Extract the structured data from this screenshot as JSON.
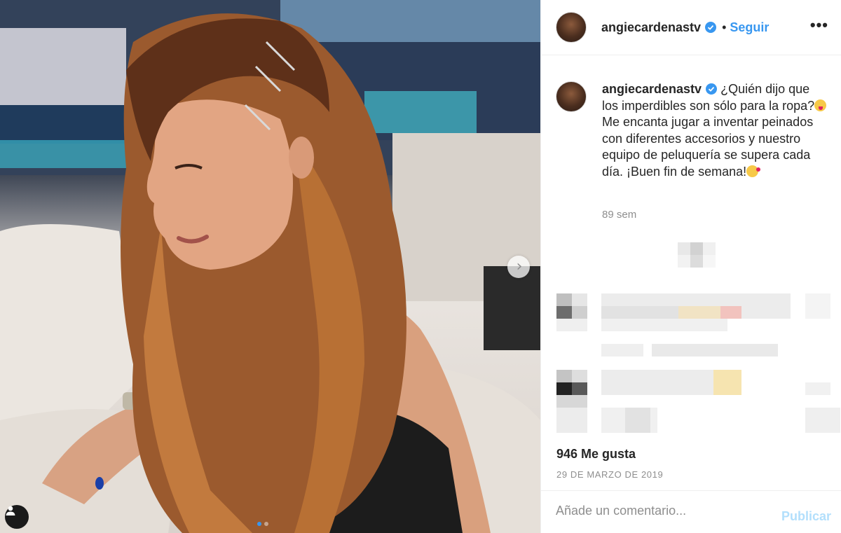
{
  "post": {
    "username": "angiecardenastv",
    "verified": true,
    "separator": "•",
    "follow_label": "Seguir",
    "more_label": "•••",
    "caption_part1": "¿Quién dijo que los imperdibles son sólo para la ropa?",
    "caption_part2": " Me encanta jugar a inventar peinados con diferentes accesorios y nuestro equipo de peluquería se supera cada día. ¡Buen fin de semana!",
    "caption_emoji_1": "grinning-face-with-tongue",
    "caption_emoji_2": "face-blowing-kiss",
    "time_ago": "89 sem",
    "likes": "946 Me gusta",
    "date": "29 DE MARZO DE 2019",
    "carousel": {
      "slides": 2,
      "active_slide": 1
    }
  },
  "comment_box": {
    "placeholder": "Añade un comentario...",
    "publish_label": "Publicar"
  },
  "icons": {
    "next": "chevron-right-icon",
    "user_tag": "user-icon",
    "verified": "verified-badge-icon",
    "more": "more-options-icon"
  },
  "colors": {
    "link_blue": "#3897f0",
    "publish_disabled": "#b2dffc",
    "secondary_text": "#8e8e8e"
  }
}
